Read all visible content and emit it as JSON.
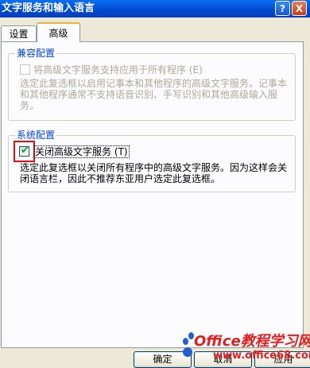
{
  "window": {
    "title": "文字服务和输入语言",
    "help_glyph": "?",
    "close_glyph": "X"
  },
  "tabs": [
    {
      "label": "设置",
      "active": false
    },
    {
      "label": "高级",
      "active": true
    }
  ],
  "compat_group": {
    "legend": "兼容配置",
    "checkbox_label": "将高级文字服务支持应用于所有程序 (E)",
    "checked": false,
    "enabled": false,
    "description": "选定此复选框以启用记事本和其他程序的高级文字服务。记事本和其他程序通常不支持语音识别、手写识别和其他高级输入服务。"
  },
  "system_group": {
    "legend": "系统配置",
    "checkbox_label": "关闭高级文字服务 (T)",
    "checked": true,
    "description": "选定此复选框以关闭所有程序中的高级文字服务。因为这样会关闭语言栏，因此不推荐东亚用户选定此复选框。"
  },
  "buttons": {
    "ok": "确定",
    "cancel": "取消",
    "apply": "应用"
  },
  "watermark": {
    "text": "Office教程学习网",
    "url": "www.office68.com"
  },
  "colors": {
    "highlight": "#e01010",
    "legend": "#0046d5",
    "title_bar": "#0048d0"
  }
}
